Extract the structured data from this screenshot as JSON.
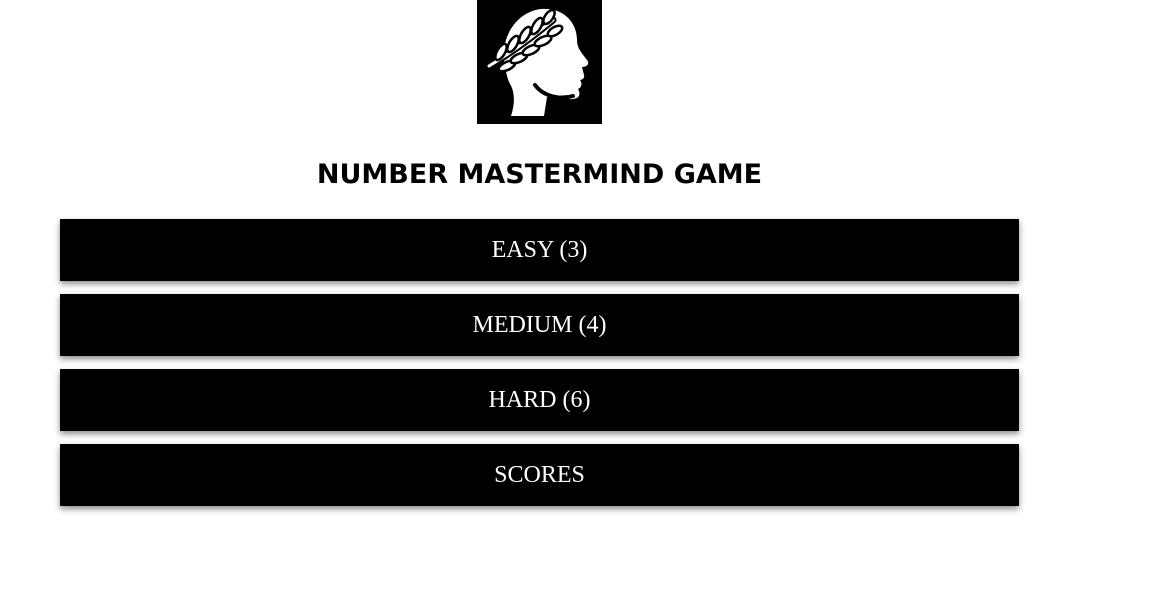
{
  "header": {
    "logo_icon": "laurel-head-icon",
    "title": "NUMBER MASTERMIND GAME"
  },
  "menu": {
    "items": [
      {
        "label": "EASY (3)"
      },
      {
        "label": "MEDIUM (4)"
      },
      {
        "label": "HARD (6)"
      },
      {
        "label": "SCORES"
      }
    ]
  },
  "colors": {
    "button_background": "#000000",
    "button_text": "#ffffff",
    "page_background": "#ffffff"
  }
}
